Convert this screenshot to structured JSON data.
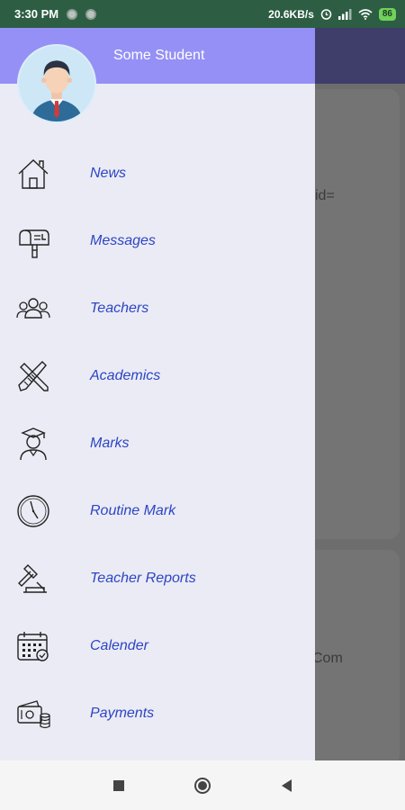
{
  "status_bar": {
    "time": "3:30 PM",
    "net_speed": "20.6KB/s",
    "battery": "86"
  },
  "background_app": {
    "snippet_1": "id=",
    "snippet_2": "Com"
  },
  "drawer": {
    "user_name": "Some Student",
    "menu": [
      {
        "label": "News",
        "icon": "home-icon"
      },
      {
        "label": "Messages",
        "icon": "mailbox-icon"
      },
      {
        "label": "Teachers",
        "icon": "group-icon"
      },
      {
        "label": "Academics",
        "icon": "pencil-ruler-icon"
      },
      {
        "label": "Marks",
        "icon": "graduate-icon"
      },
      {
        "label": "Routine Mark",
        "icon": "clock-icon"
      },
      {
        "label": "Teacher Reports",
        "icon": "gavel-icon"
      },
      {
        "label": "Calender",
        "icon": "calendar-icon"
      },
      {
        "label": "Payments",
        "icon": "payment-icon"
      }
    ]
  },
  "colors": {
    "header": "#9590f5",
    "menu_text": "#2c45c4",
    "drawer_bg": "#ebebf5",
    "status_bar": "#2d5e44"
  }
}
